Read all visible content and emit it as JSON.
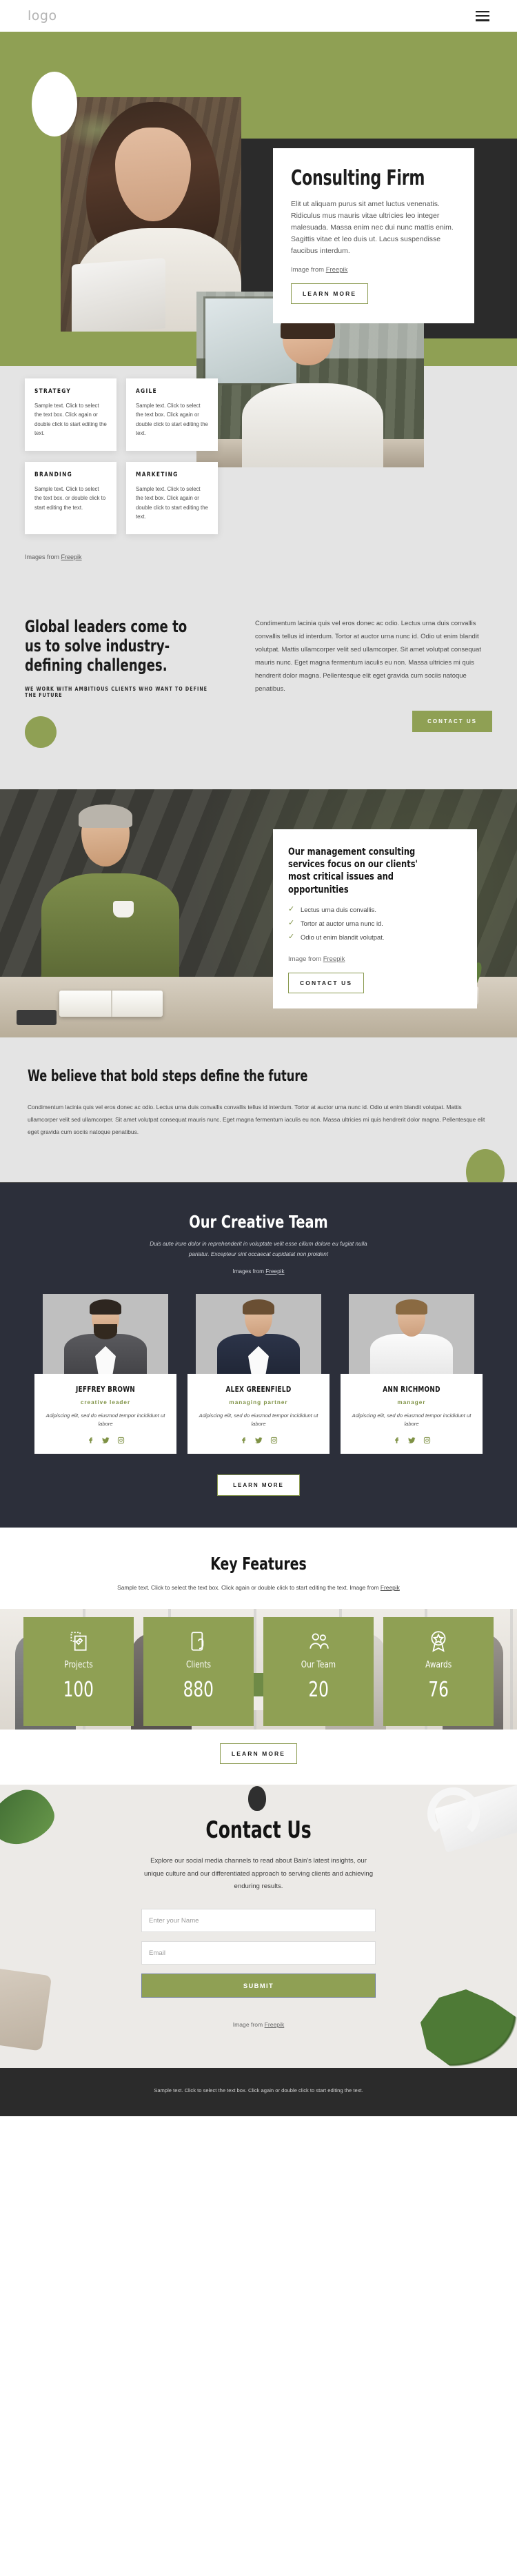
{
  "header": {
    "logo": "logo",
    "menu_icon": "hamburger-menu"
  },
  "hero": {
    "title": "Consulting Firm",
    "body": "Elit ut aliquam purus sit amet luctus venenatis. Ridiculus mus mauris vitae ultricies leo integer malesuada. Massa enim nec dui nunc mattis enim. Sagittis vitae et leo duis ut. Lacus suspendisse faucibus interdum.",
    "credit_prefix": "Image from ",
    "credit_link": "Freepik",
    "cta": "LEARN MORE"
  },
  "services": {
    "cards": [
      {
        "title": "STRATEGY",
        "text": "Sample text. Click to select the text box. Click again or double click to start editing the text."
      },
      {
        "title": "AGILE",
        "text": "Sample text. Click to select the text box. Click again or double click to start editing the text."
      },
      {
        "title": "BRANDING",
        "text": "Sample text. Click to select the text box.            or double click to start editing the text."
      },
      {
        "title": "MARKETING",
        "text": "Sample text. Click to select the text box. Click again or double click to start editing the text."
      }
    ],
    "credit_prefix": "Images from ",
    "credit_link": "Freepik"
  },
  "leaders": {
    "title": "Global leaders come to us to solve industry-defining challenges.",
    "eyebrow": "WE WORK WITH AMBITIOUS CLIENTS WHO WANT TO DEFINE THE FUTURE",
    "body": "Condimentum lacinia quis vel eros donec ac odio. Lectus urna duis convallis convallis tellus id interdum. Tortor at auctor urna nunc id. Odio ut enim blandit volutpat. Mattis ullamcorper velit sed ullamcorper. Sit amet volutpat consequat mauris nunc. Eget magna fermentum iaculis eu non. Massa ultricies mi quis hendrerit dolor magna. Pellentesque elit eget gravida cum sociis natoque penatibus.",
    "cta": "CONTACT US"
  },
  "management": {
    "title": "Our management consulting services focus on our clients' most critical issues and opportunities",
    "bullets": [
      "Lectus urna duis convallis.",
      "Tortor at auctor urna nunc id.",
      "Odio ut enim blandit volutpat."
    ],
    "credit_prefix": "Image from ",
    "credit_link": "Freepik",
    "cta": "CONTACT US"
  },
  "bold": {
    "title": "We believe that bold steps define the future",
    "body": "Condimentum lacinia quis vel eros donec ac odio. Lectus urna duis convallis convallis tellus id interdum. Tortor at auctor urna nunc id. Odio ut enim blandit volutpat. Mattis ullamcorper velit sed ullamcorper. Sit amet volutpat consequat mauris nunc. Eget magna fermentum iaculis eu non. Massa ultricies mi quis hendrerit dolor magna. Pellentesque elit eget gravida cum sociis natoque penatibus."
  },
  "team": {
    "title": "Our Creative Team",
    "subtitle": "Duis aute irure dolor in reprehenderit in voluptate velit esse cillum dolore eu fugiat nulla pariatur. Excepteur sint occaecat cupidatat non proident",
    "credit_prefix": "Images from ",
    "credit_link": "Freepik",
    "members": [
      {
        "name": "JEFFREY BROWN",
        "role": "creative leader",
        "bio": "Adipiscing elit, sed do eiusmod tempor incididunt ut labore"
      },
      {
        "name": "ALEX GREENFIELD",
        "role": "managing partner",
        "bio": "Adipiscing elit, sed do eiusmod tempor incididunt ut labore"
      },
      {
        "name": "ANN RICHMOND",
        "role": "manager",
        "bio": "Adipiscing elit, sed do eiusmod tempor incididunt ut labore"
      }
    ],
    "cta": "LEARN MORE"
  },
  "key_features": {
    "title": "Key Features",
    "subtitle": "Sample text. Click to select the text box. Click again or double click to start editing the text. Image from ",
    "credit_link": "Freepik",
    "stats": [
      {
        "label": "Projects",
        "value": "100",
        "icon": "design-document-icon"
      },
      {
        "label": "Clients",
        "value": "880",
        "icon": "tap-phone-icon"
      },
      {
        "label": "Our Team",
        "value": "20",
        "icon": "people-group-icon"
      },
      {
        "label": "Awards",
        "value": "76",
        "icon": "award-badge-icon"
      }
    ],
    "cta": "LEARN MORE"
  },
  "contact": {
    "title": "Contact Us",
    "subtitle": "Explore our social media channels to read about Bain's latest insights, our unique culture and our differentiated approach to serving clients and achieving enduring results.",
    "name_placeholder": "Enter your Name",
    "name_value": "",
    "email_placeholder": "Email",
    "email_value": "",
    "submit": "SUBMIT",
    "credit_prefix": "Image from ",
    "credit_link": "Freepik"
  },
  "footer": {
    "text": "Sample text. Click to select the text box. Click again or double click to start editing the text."
  },
  "colors": {
    "brand_green": "#8fa054",
    "dark": "#2b2b2b",
    "team_bg": "#2c2f3a",
    "light_gray": "#e4e4e4"
  }
}
